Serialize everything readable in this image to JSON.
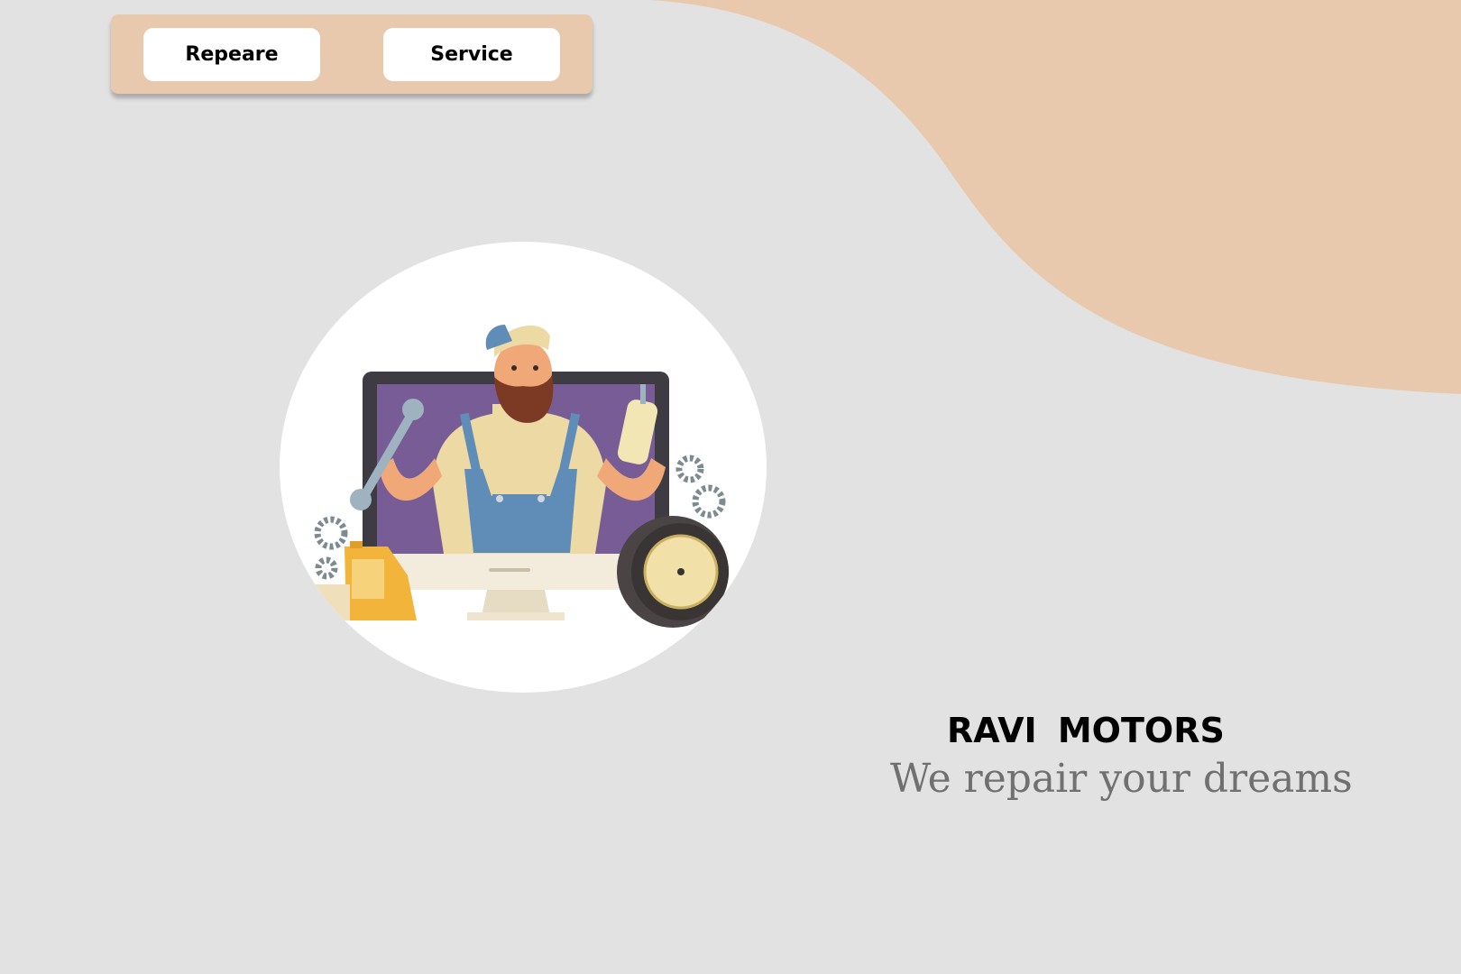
{
  "nav": {
    "repair_label": "Repeare",
    "service_label": "Service"
  },
  "brand": {
    "name": "RAVI  MOTORS",
    "tagline": "We repair your dreams"
  },
  "hero": {
    "illustration": "mechanic-in-monitor-illustration"
  },
  "colors": {
    "background": "#e2e2e2",
    "accent": "#e9c9ad",
    "button_bg": "#ffffff",
    "tagline": "#707070"
  }
}
